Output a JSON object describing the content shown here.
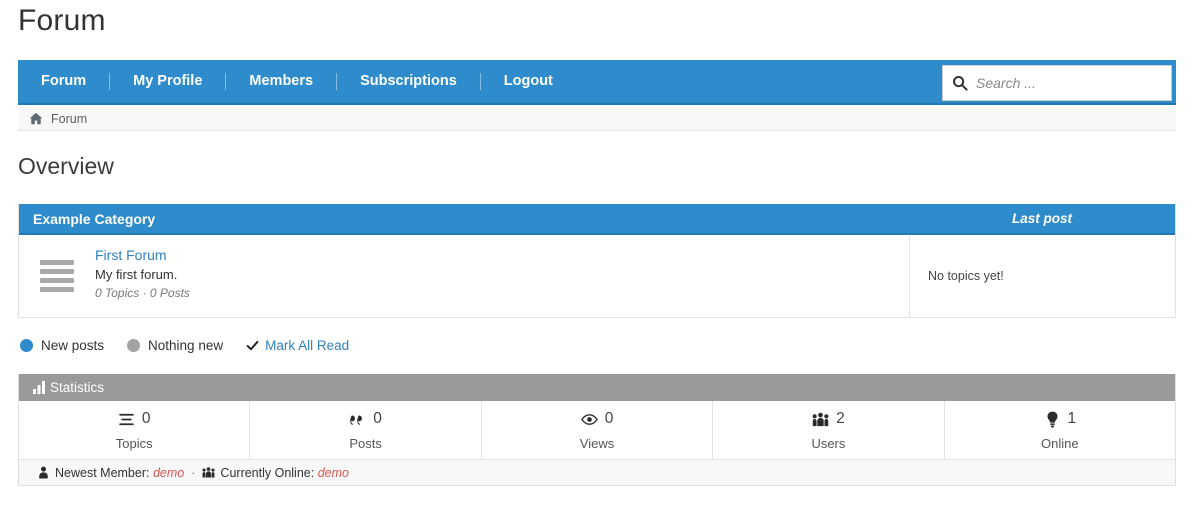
{
  "site": {
    "title": "Forum"
  },
  "nav": {
    "items": [
      {
        "label": "Forum"
      },
      {
        "label": "My Profile"
      },
      {
        "label": "Members"
      },
      {
        "label": "Subscriptions"
      },
      {
        "label": "Logout"
      }
    ],
    "search": {
      "value": "",
      "placeholder": "Search ...",
      "icon": "search-icon"
    }
  },
  "breadcrumb": {
    "icon": "home-icon",
    "text": "Forum"
  },
  "heading": "Overview",
  "category": {
    "title": "Example Category",
    "last_post_header": "Last post",
    "forums": [
      {
        "icon": "list-icon",
        "name": "First Forum",
        "description": "My first forum.",
        "stats": "0 Topics · 0 Posts",
        "last_post": "No topics yet!"
      }
    ]
  },
  "legend": {
    "new_posts": "New posts",
    "nothing_new": "Nothing new",
    "mark_all_read": "Mark All Read",
    "new_color": "#2e8ccc",
    "old_color": "#a3a3a3"
  },
  "statistics": {
    "title": "Statistics",
    "icon": "bar-chart-icon",
    "cells": [
      {
        "icon": "list-lines-icon",
        "value": "0",
        "label": "Topics"
      },
      {
        "icon": "quote-icon",
        "value": "0",
        "label": "Posts"
      },
      {
        "icon": "eye-icon",
        "value": "0",
        "label": "Views"
      },
      {
        "icon": "users-icon",
        "value": "2",
        "label": "Users"
      },
      {
        "icon": "lightbulb-icon",
        "value": "1",
        "label": "Online"
      }
    ],
    "footer": {
      "newest_member_label": "Newest Member:",
      "newest_member_value": "demo",
      "separator": "·",
      "currently_online_label": "Currently Online:",
      "currently_online_value": "demo",
      "newest_member_icon": "person-icon",
      "currently_online_icon": "users-icon"
    }
  },
  "colors": {
    "brand_blue": "#2e8ccc",
    "brand_blue_dark": "#2279b4",
    "link_blue": "#3182bd",
    "stats_gray": "#9a9a9a",
    "user_red": "#d9534f"
  }
}
